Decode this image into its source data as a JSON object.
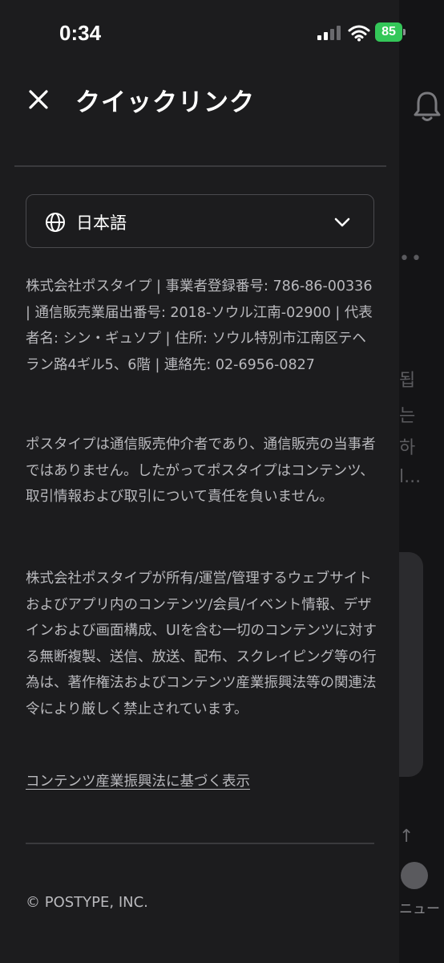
{
  "status_bar": {
    "time": "0:34",
    "battery": "85"
  },
  "header": {
    "title": "クイックリンク"
  },
  "language_selector": {
    "value": "日本語"
  },
  "paragraphs": [
    "株式会社ポスタイプ | 事業者登録番号: 786-86-00336 | 通信販売業届出番号: 2018-ソウル江南-02900 | 代表者名: シン・ギュソプ | 住所: ソウル特別市江南区テヘラン路4ギル5、6階 | 連絡先: 02-6956-0827",
    "ポスタイプは通信販売仲介者であり、通信販売の当事者ではありません。したがってポスタイプはコンテンツ、取引情報および取引について責任を負いません。",
    "株式会社ポスタイプが所有/運営/管理するウェブサイトおよびアプリ内のコンテンツ/会員/イベント情報、デザインおよび画面構成、UIを含む一切のコンテンツに対する無断複製、送信、放送、配布、スクレイピング等の行為は、著作権法およびコンテンツ産業振興法等の関連法令により厳しく禁止されています。"
  ],
  "link_text": "コンテンツ産業振興法に基づく表示",
  "copyright": "© POSTYPE, INC.",
  "background_page": {
    "text_fragments": [
      "됩",
      "는",
      "하",
      "l..."
    ],
    "menu_label": "ニュー"
  },
  "colors": {
    "drawer_bg": "#1c1c1e",
    "battery_green": "#34c759",
    "text_secondary": "#b9b9bd"
  }
}
